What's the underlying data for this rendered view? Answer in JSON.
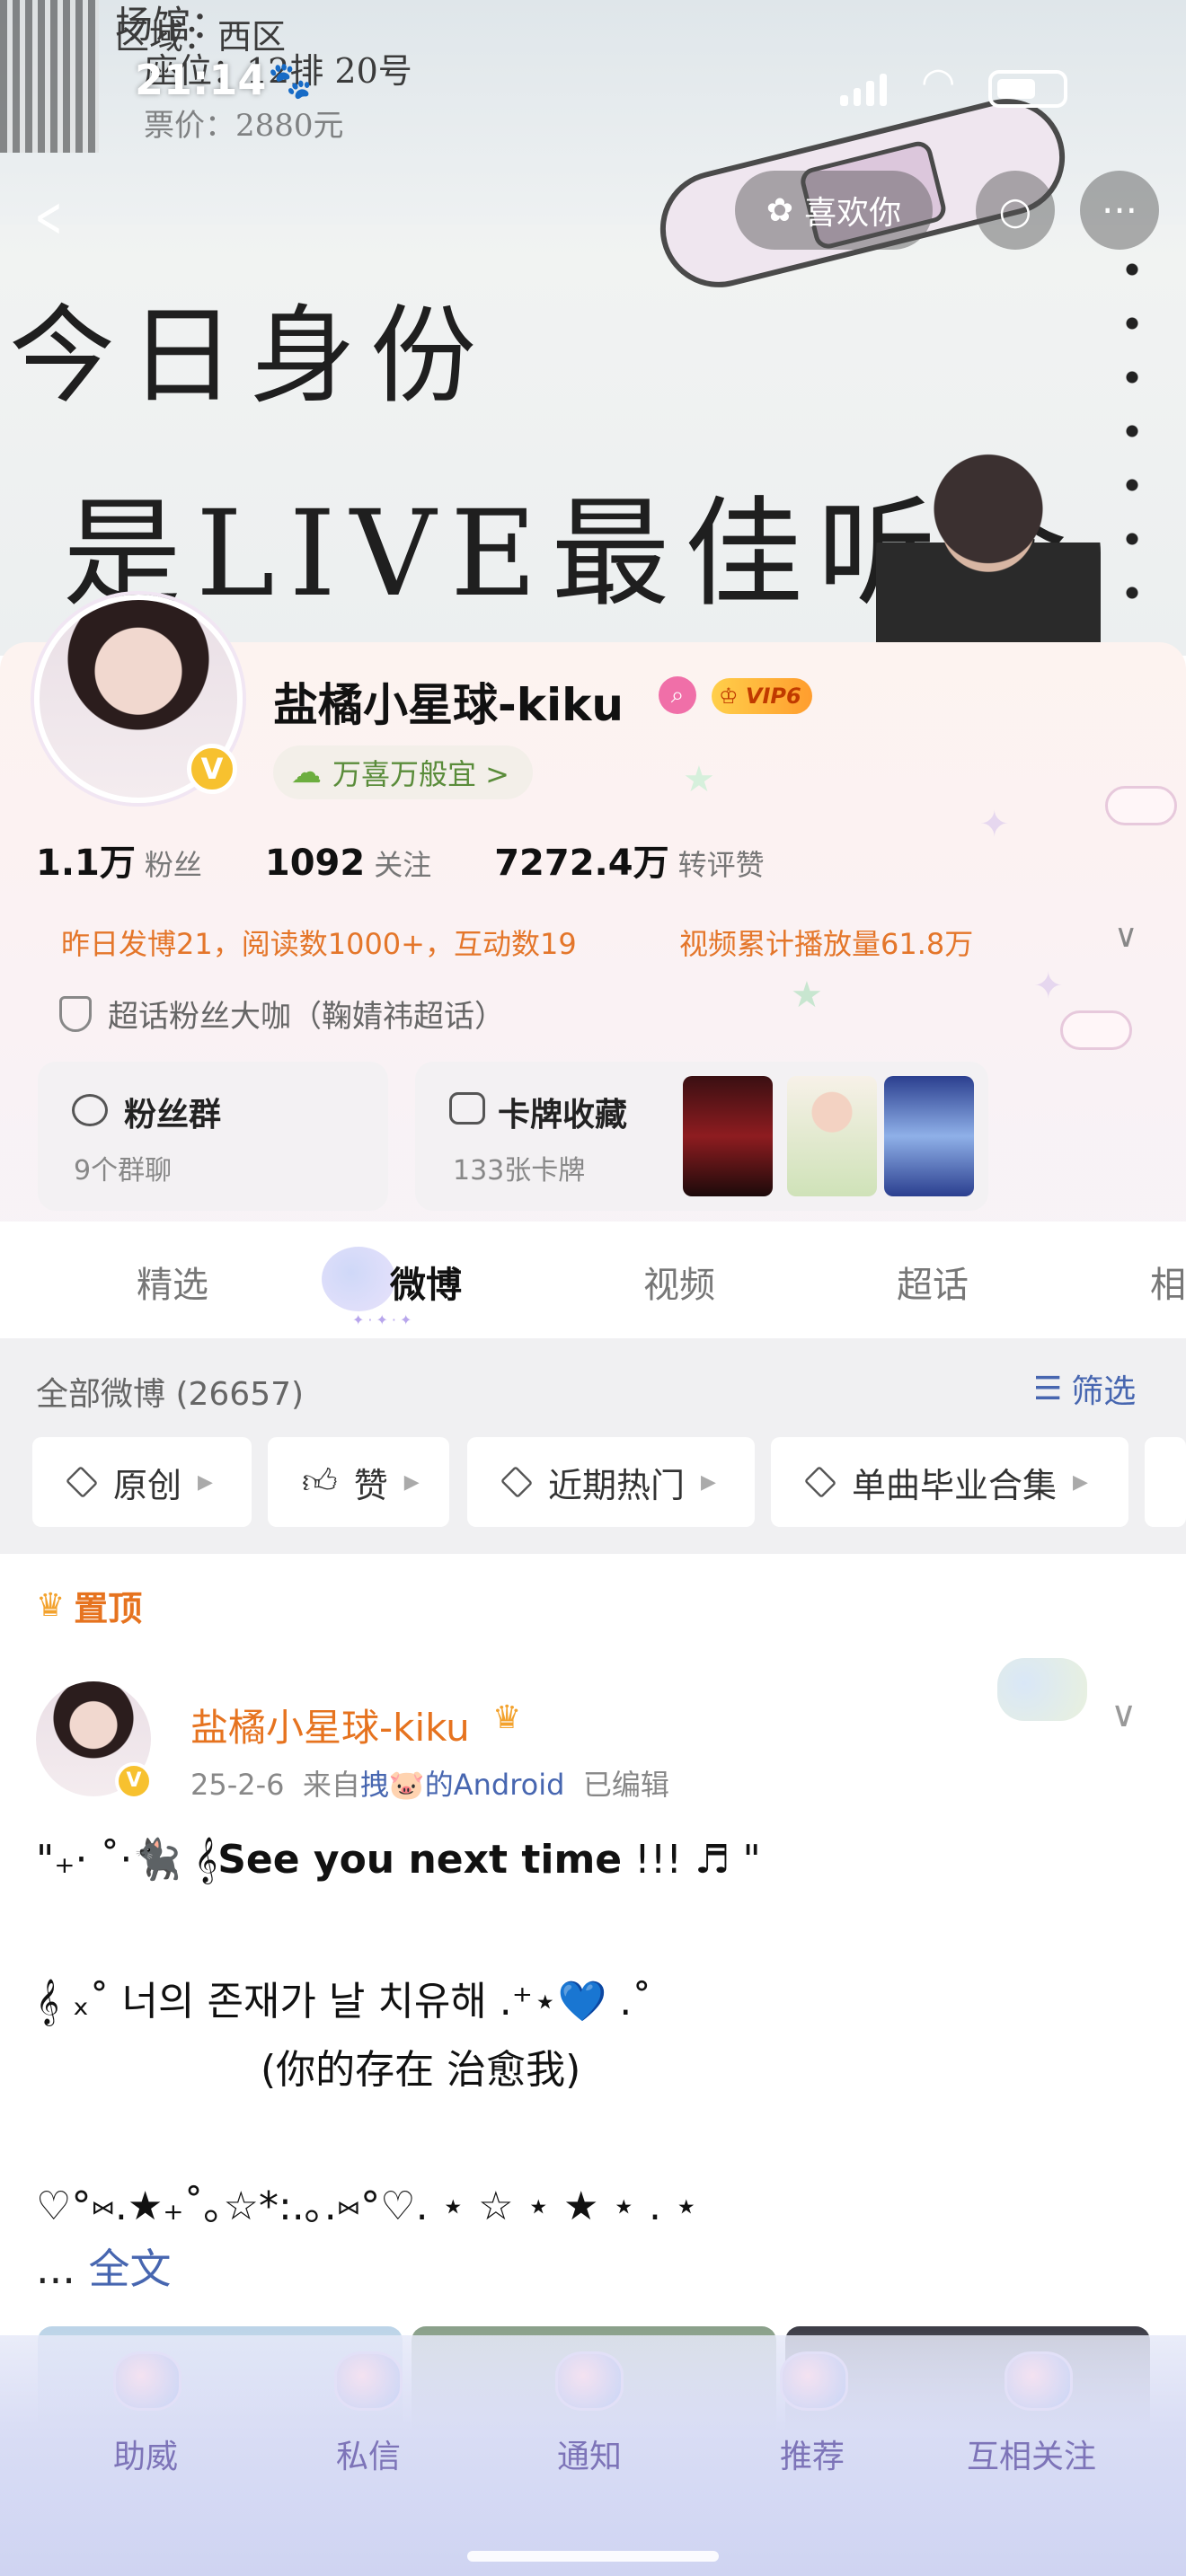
{
  "status_bar": {
    "time": "21:14"
  },
  "banner": {
    "ticket_lines": [
      "场馆：",
      "区域：西区",
      "座位：12排  20号",
      "票价：2880元"
    ],
    "handwriting_1": "今日身份",
    "handwriting_2": "是LIVE最佳听众"
  },
  "header": {
    "like_label": "喜欢你"
  },
  "profile": {
    "username": "盐橘小星球-kiku",
    "vip_label": "VIP6",
    "wish_label": "万喜万般宜 >",
    "stats": [
      {
        "value": "1.1万",
        "label": "粉丝"
      },
      {
        "value": "1092",
        "label": "关注"
      },
      {
        "value": "7272.4万",
        "label": "转评赞"
      }
    ],
    "summary_left": "昨日发博21，阅读数1000+，互动数19",
    "summary_right": "视频累计播放量61.8万",
    "supertopic": "超话粉丝大咖（鞠婧祎超话）",
    "fan_group": {
      "title": "粉丝群",
      "sub": "9个群聊"
    },
    "cards": {
      "title": "卡牌收藏",
      "sub": "133张卡牌"
    }
  },
  "tabs": [
    "精选",
    "微博",
    "视频",
    "超话",
    "相"
  ],
  "active_tab": "微博",
  "filter": {
    "all_label": "全部微博 (26657)",
    "filter_label": "筛选",
    "chips": [
      "原创",
      "赞",
      "近期热门",
      "单曲毕业合集"
    ]
  },
  "post": {
    "pinned_label": "置顶",
    "author": "盐橘小星球-kiku",
    "meta_date": "25-2-6",
    "meta_from": "来自",
    "meta_source": "拽🐷的Android",
    "meta_edited": "已编辑",
    "line1_prefix": "\"₊· ˚·🐈‍⬛ 𝄞",
    "line1_bold": "See you next time",
    "line1_suffix": " !!! ♬ \"",
    "line2": "𝄞 ₓ˚ 너의 존재가 날 치유해 .⁺⋆💙 .˚",
    "line3": "(你的存在 治愈我)",
    "line4": "♡°⑅.★₊˚｡☆*:.｡.⑅°♡. ⋆ ☆ ⋆ ★ ⋆ . ⋆",
    "ellipsis": "... ",
    "fulltext": "全文"
  },
  "bottom_nav": [
    "助威",
    "私信",
    "通知",
    "推荐",
    "互相关注"
  ],
  "colors": {
    "accent_orange": "#e6731f",
    "link_blue": "#4766b0",
    "nav_purple": "#7d74b8"
  }
}
